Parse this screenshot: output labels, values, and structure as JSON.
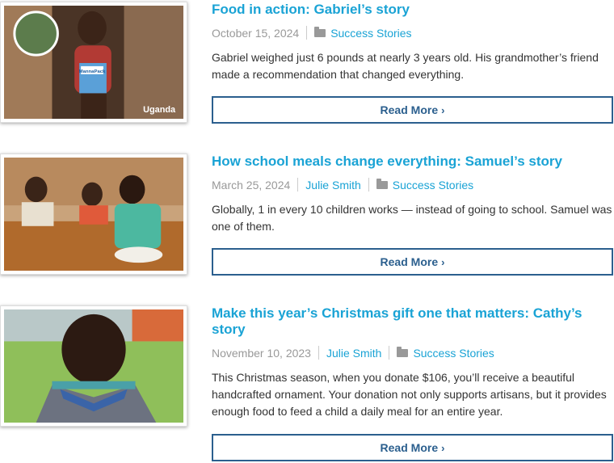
{
  "read_more_label": "Read More",
  "read_more_chevron": "›",
  "posts": [
    {
      "title": "Food in action: Gabriel’s story",
      "date": "October 15, 2024",
      "author": "",
      "category": "Success Stories",
      "excerpt": "Gabriel weighed just 6 pounds at nearly 3 years old. His grandmother’s friend made a recommendation that changed everything.",
      "image_caption": "Uganda",
      "image_badge_text": "MannaPack"
    },
    {
      "title": "How school meals change everything: Samuel’s story",
      "date": "March 25, 2024",
      "author": "Julie Smith",
      "category": "Success Stories",
      "excerpt": "Globally, 1 in every 10 children works — instead of going to school. Samuel was one of them."
    },
    {
      "title": "Make this year’s Christmas gift one that matters: Cathy’s story",
      "date": "November 10, 2023",
      "author": "Julie Smith",
      "category": "Success Stories",
      "excerpt": "This Christmas season, when you donate $106, you’ll receive a beautiful handcrafted ornament. Your donation not only supports artisans, but it provides enough food to feed a child a daily meal for an entire year."
    }
  ],
  "colors": {
    "title": "#1aa3d5",
    "button": "#2b5f8e",
    "meta": "#999999"
  }
}
